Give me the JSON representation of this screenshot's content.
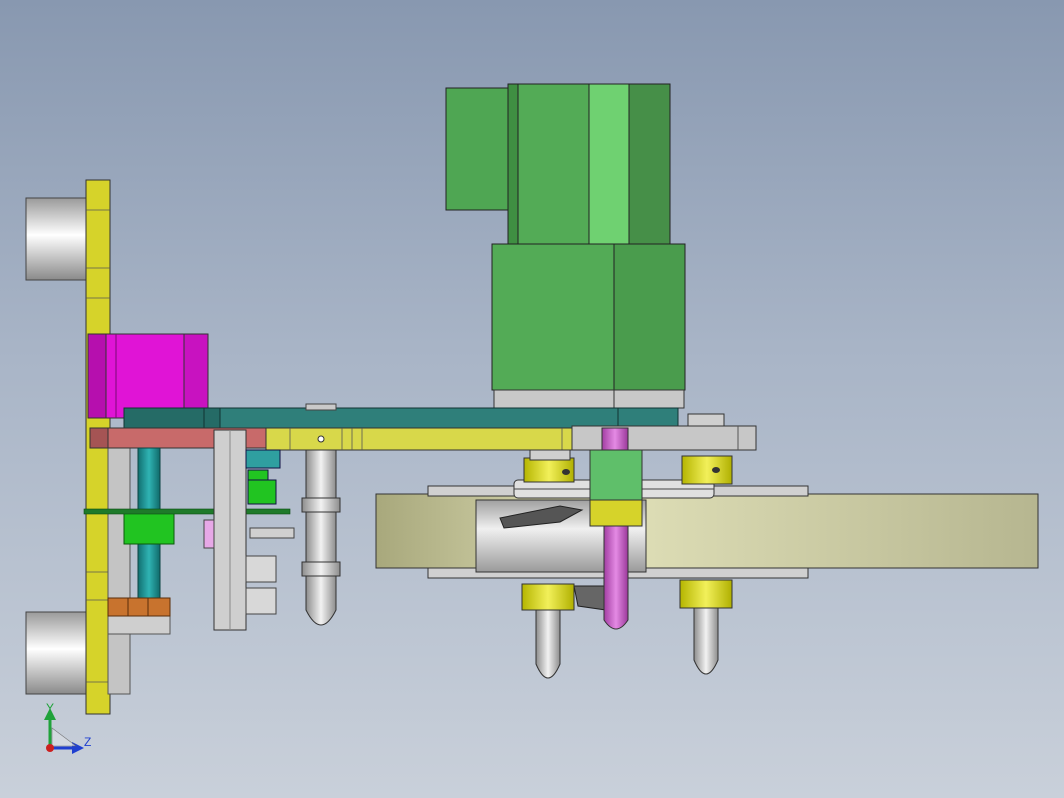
{
  "viewport": {
    "background_top": "#8898b0",
    "background_bottom": "#c9d0da"
  },
  "triad": {
    "y_label": "Y",
    "z_label": "Z",
    "y_color": "#1fa23a",
    "z_color": "#1f3fd0",
    "origin_color": "#cc1f1f"
  },
  "colors": {
    "motor_green": "#52aa55",
    "plate_teal": "#2f7f7a",
    "plate_yellow": "#d8d84a",
    "bracket_yellow": "#d6d32a",
    "magenta_block": "#e014d6",
    "wheel_beige": "#d6d6a8",
    "grey_metal": "#c4c4c4",
    "shaft_teal": "#1d8f90",
    "gear_green": "#21c421",
    "pin_purple": "#c95ac9",
    "copper": "#c8732e",
    "salmon": "#c86a6a"
  }
}
